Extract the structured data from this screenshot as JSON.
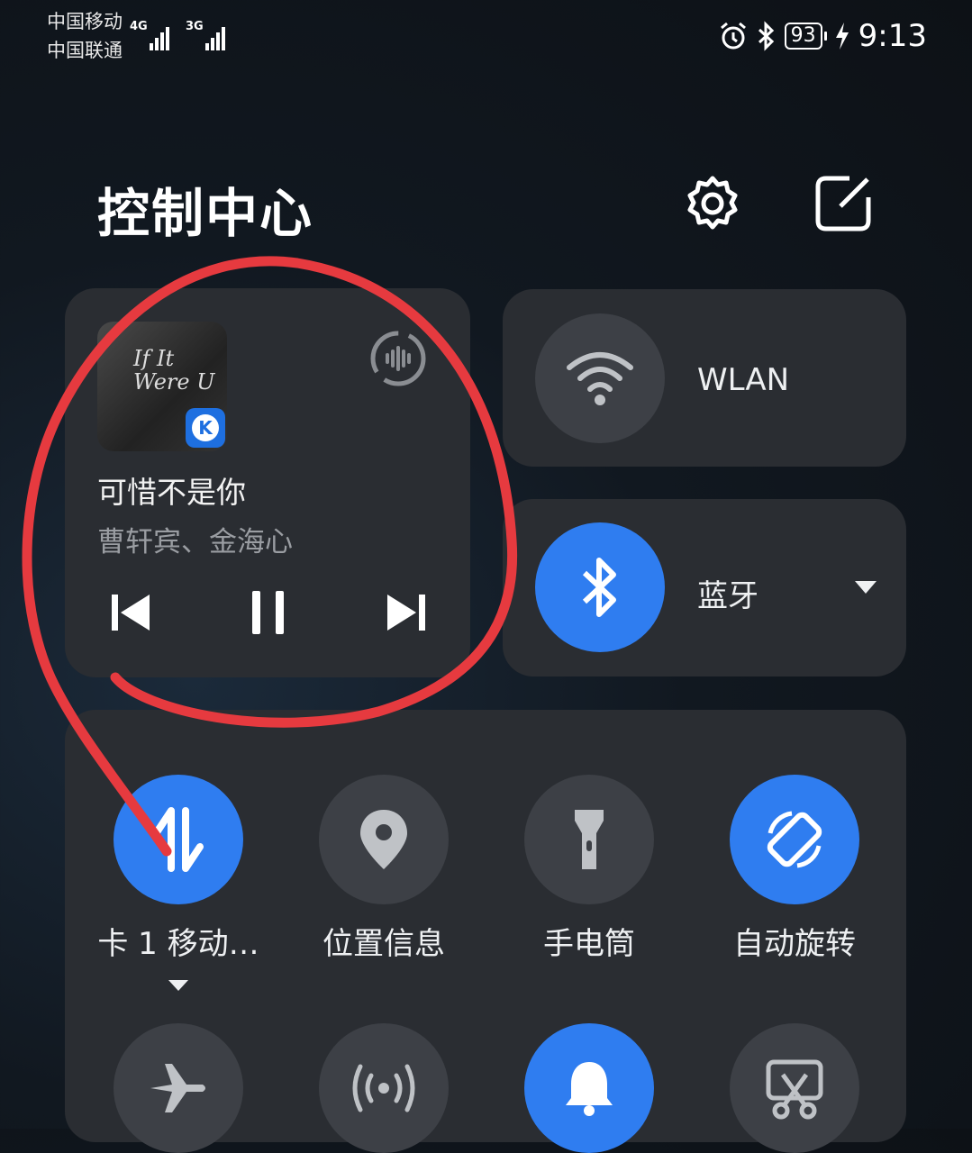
{
  "status_bar": {
    "carrier1": "中国移动",
    "carrier2": "中国联通",
    "net1": "4G",
    "net2": "3G",
    "battery": "93",
    "time": "9:13"
  },
  "header": {
    "title": "控制中心"
  },
  "media": {
    "album_art_text": "If It Were U",
    "song": "可惜不是你",
    "artist": "曹轩宾、金海心"
  },
  "wlan": {
    "label": "WLAN"
  },
  "bluetooth": {
    "label": "蓝牙"
  },
  "toggles": [
    {
      "label": "卡 1 移动…",
      "icon": "mobile-data-icon",
      "active": true
    },
    {
      "label": "位置信息",
      "icon": "location-icon",
      "active": false
    },
    {
      "label": "手电筒",
      "icon": "flashlight-icon",
      "active": false
    },
    {
      "label": "自动旋转",
      "icon": "auto-rotate-icon",
      "active": true
    }
  ],
  "toggles_row2": [
    {
      "icon": "airplane-icon",
      "active": false
    },
    {
      "icon": "hotspot-icon",
      "active": false
    },
    {
      "icon": "bell-icon",
      "active": true
    },
    {
      "icon": "screenshot-icon",
      "active": false
    }
  ],
  "colors": {
    "accent": "#2f7df0",
    "tile": "#3d4046",
    "panel": "#2a2d32",
    "annotation": "#e63a3f"
  }
}
